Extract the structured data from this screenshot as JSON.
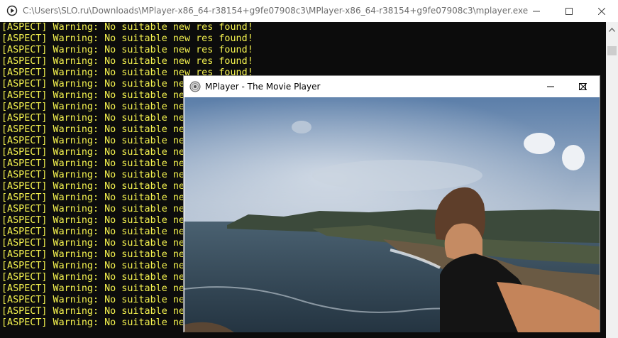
{
  "console": {
    "title": "C:\\Users\\SLO.ru\\Downloads\\MPlayer-x86_64-r38154+g9fe07908c3\\MPlayer-x86_64-r38154+g9fe07908c3\\mplayer.exe",
    "lines": [
      "[ASPECT] Warning: No suitable new res found!",
      "[ASPECT] Warning: No suitable new res found!",
      "[ASPECT] Warning: No suitable new res found!",
      "[ASPECT] Warning: No suitable new res found!",
      "[ASPECT] Warning: No suitable new res found!",
      "[ASPECT] Warning: No suitable new res found!",
      "[ASPECT] Warning: No suitable new res found!",
      "[ASPECT] Warning: No suitable new res found!",
      "[ASPECT] Warning: No suitable new res found!",
      "[ASPECT] Warning: No suitable new res found!",
      "[ASPECT] Warning: No suitable new res found!",
      "[ASPECT] Warning: No suitable new res found!",
      "[ASPECT] Warning: No suitable new res found!",
      "[ASPECT] Warning: No suitable new res found!",
      "[ASPECT] Warning: No suitable new res found!",
      "[ASPECT] Warning: No suitable new res found!",
      "[ASPECT] Warning: No suitable new res found!",
      "[ASPECT] Warning: No suitable new res found!",
      "[ASPECT] Warning: No suitable new res found!",
      "[ASPECT] Warning: No suitable new res found!",
      "[ASPECT] Warning: No suitable new res found!",
      "[ASPECT] Warning: No suitable new res found!",
      "[ASPECT] Warning: No suitable new res found!",
      "[ASPECT] Warning: No suitable new res found!",
      "[ASPECT] Warning: No suitable new res found!",
      "[ASPECT] Warning: No suitable new res found!",
      "[ASPECT] Warning: No suitable new res found!"
    ],
    "text_color": "#f6f44f",
    "background_color": "#0c0c0c"
  },
  "player": {
    "title": "MPlayer - The Movie Player"
  },
  "icons": {
    "console_app": "mplayer-play-icon",
    "player_app": "mplayer-disc-icon",
    "minimize": "minimize-icon",
    "maximize": "maximize-icon",
    "close": "close-icon",
    "scroll_up": "scroll-up-arrow-icon"
  }
}
